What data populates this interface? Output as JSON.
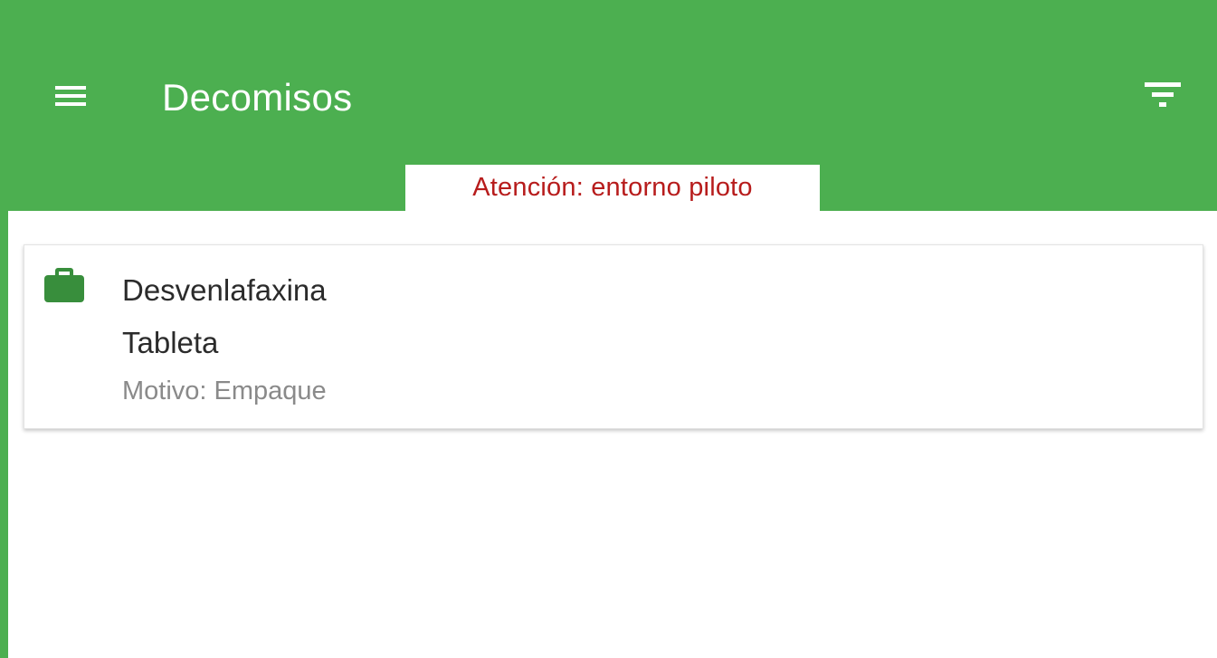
{
  "header": {
    "title": "Decomisos",
    "menu_icon": "menu-icon",
    "filter_icon": "filter-icon",
    "background_color": "#4caf50"
  },
  "banner": {
    "text": "Atención: entorno piloto",
    "text_color": "#b71c1c"
  },
  "items": [
    {
      "icon": "briefcase-icon",
      "icon_color": "#388e3c",
      "name": "Desvenlafaxina",
      "form": "Tableta",
      "reason": "Motivo: Empaque"
    }
  ]
}
